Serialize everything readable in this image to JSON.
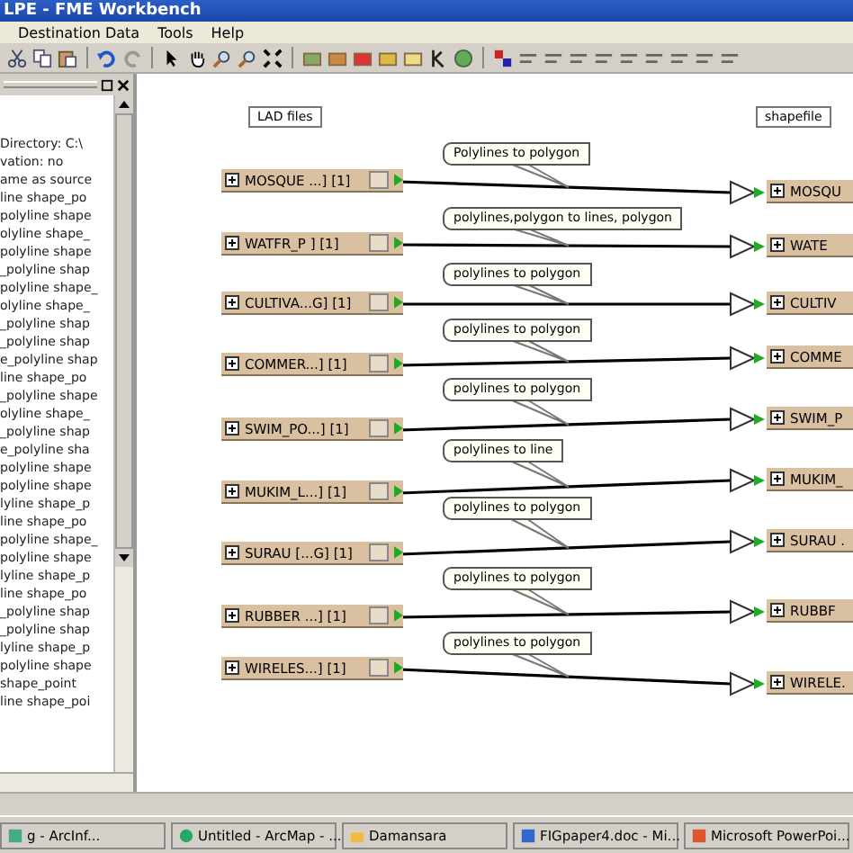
{
  "window": {
    "title": "LPE - FME Workbench"
  },
  "menu": [
    "Destination Data",
    "Tools",
    "Help"
  ],
  "navigator": {
    "lines": [
      "Directory: C:\\",
      "vation: no",
      "ame as source",
      "line shape_po",
      "polyline shape",
      "olyline shape_",
      "polyline shape",
      "_polyline shap",
      "polyline shape_",
      "olyline shape_",
      "_polyline shap",
      "_polyline shap",
      "e_polyline shap",
      "line shape_po",
      "_polyline shape",
      "olyline shape_",
      "_polyline shap",
      "e_polyline sha",
      "polyline shape",
      "polyline shape",
      "lyline shape_p",
      "line shape_po",
      "polyline shape_",
      "polyline shape",
      "lyline shape_p",
      "line shape_po",
      "_polyline shap",
      "_polyline shap",
      "lyline shape_p",
      "polyline shape",
      "shape_point",
      "line shape_poi"
    ]
  },
  "canvas": {
    "source_label": "LAD files",
    "destination_label": "shapefile",
    "flows": [
      {
        "source": "MOSQUE ...] [1]",
        "note": "Polylines to polygon",
        "destination": "MOSQU"
      },
      {
        "source": "WATFR_P  ] [1]",
        "note": "polylines,polygon to lines, polygon",
        "destination": "WATE"
      },
      {
        "source": "CULTIVA...G] [1]",
        "note": "polylines to polygon",
        "destination": "CULTIV"
      },
      {
        "source": "COMMER...] [1]",
        "note": "polylines to polygon",
        "destination": "COMME"
      },
      {
        "source": "SWIM_PO...] [1]",
        "note": "polylines to polygon",
        "destination": "SWIM_P"
      },
      {
        "source": "MUKIM_L...] [1]",
        "note": "polylines to line",
        "destination": "MUKIM_"
      },
      {
        "source": "SURAU [...G] [1]",
        "note": "polylines to polygon",
        "destination": "SURAU ."
      },
      {
        "source": "RUBBER ...] [1]",
        "note": "polylines to polygon",
        "destination": "RUBBF"
      },
      {
        "source": "WIRELES...] [1]",
        "note": "polylines to polygon",
        "destination": "WIRELE."
      }
    ]
  },
  "taskbar": [
    "g - ArcInf...",
    "Untitled - ArcMap - ...",
    "Damansara",
    "FIGpaper4.doc - Mi...",
    "Microsoft PowerPoi..."
  ]
}
